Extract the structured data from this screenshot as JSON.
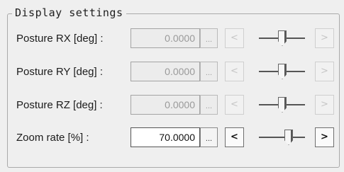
{
  "group": {
    "title": "Display settings"
  },
  "rows": [
    {
      "label": "Posture RX [deg] :",
      "value": "0.0000",
      "ellipsis": "...",
      "left_button": "<",
      "right_button": ">",
      "enabled": false,
      "slider_level": 0.5
    },
    {
      "label": "Posture RY [deg] :",
      "value": "0.0000",
      "ellipsis": "...",
      "left_button": "<",
      "right_button": ">",
      "enabled": false,
      "slider_level": 0.5
    },
    {
      "label": "Posture RZ [deg] :",
      "value": "0.0000",
      "ellipsis": "...",
      "left_button": "<",
      "right_button": ">",
      "enabled": false,
      "slider_level": 0.5
    },
    {
      "label": "Zoom rate [%] :",
      "value": "70.0000",
      "ellipsis": "...",
      "left_button": "<",
      "right_button": ">",
      "enabled": true,
      "slider_level": 0.6
    }
  ]
}
